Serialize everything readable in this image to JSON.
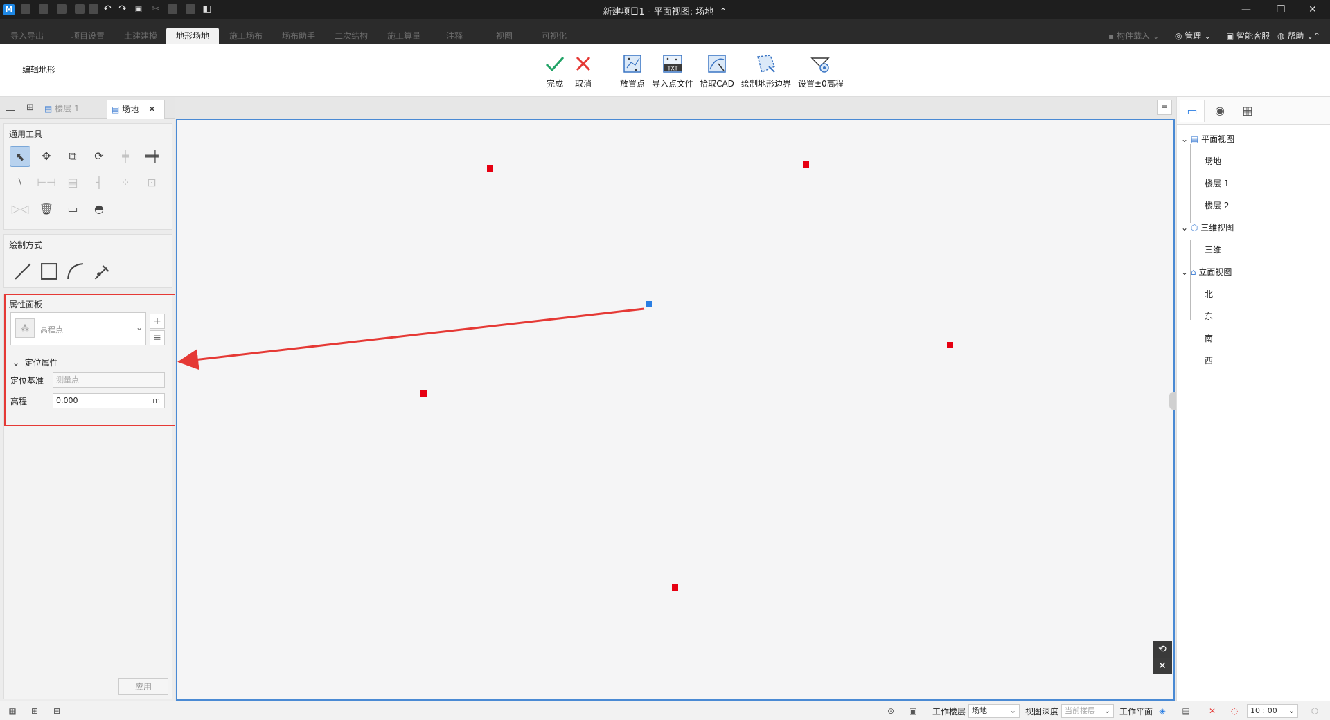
{
  "app": {
    "logo_letter": "M",
    "window_title": "新建项目1 - 平面视图: 场地",
    "title_chevron": "⌃"
  },
  "window_controls": {
    "minimize": "—",
    "restore": "❐",
    "close": "✕"
  },
  "ribbon_tabs": [
    {
      "label": "导入导出",
      "active": false
    },
    {
      "label": "项目设置",
      "active": false
    },
    {
      "label": "土建建模",
      "active": false
    },
    {
      "label": "地形场地",
      "active": true
    },
    {
      "label": "施工场布",
      "active": false
    },
    {
      "label": "场布助手",
      "active": false
    },
    {
      "label": "二次结构",
      "active": false
    },
    {
      "label": "施工算量",
      "active": false
    },
    {
      "label": "注释",
      "active": false
    },
    {
      "label": "视图",
      "active": false
    },
    {
      "label": "可视化",
      "active": false
    }
  ],
  "top_right": {
    "component_load": "构件载入",
    "manage": "管理",
    "service": "智能客服",
    "help": "帮助"
  },
  "ribbon": {
    "mode_label": "编辑地形",
    "finish": "完成",
    "cancel": "取消",
    "place_point": "放置点",
    "import_points": "导入点文件",
    "pick_cad": "拾取CAD",
    "draw_boundary": "绘制地形边界",
    "set_zero_elev": "设置±0高程",
    "txt_badge": "TXT",
    "accent_color": "#21a366",
    "cancel_color": "#e53935"
  },
  "view_tabs": {
    "floor1": "楼层 1",
    "site": "场地",
    "close": "✕"
  },
  "general_tools": {
    "title": "通用工具"
  },
  "draw_mode": {
    "title": "绘制方式"
  },
  "properties": {
    "title": "属性面板",
    "type_name": "高程点",
    "add": "+",
    "list": "≡",
    "section": "定位属性",
    "base_label": "定位基准",
    "base_placeholder": "测量点",
    "elev_label": "高程",
    "elev_value": "0.000",
    "elev_unit": "m",
    "apply": "应用"
  },
  "canvas": {
    "menu": "≡",
    "points_red": [
      {
        "id": "p1"
      },
      {
        "id": "p2"
      },
      {
        "id": "p3"
      },
      {
        "id": "p4"
      },
      {
        "id": "p5"
      }
    ],
    "point_color": "#e60012",
    "selected_color": "#2a7ee3"
  },
  "project_tree": {
    "plan_view": "平面视图",
    "site": "场地",
    "floor1": "楼层 1",
    "floor2": "楼层 2",
    "view3d": "三维视图",
    "d3": "三维",
    "elevation": "立面视图",
    "north": "北",
    "east": "东",
    "south": "南",
    "west": "西"
  },
  "status_bar": {
    "work_floor_label": "工作楼层",
    "work_floor_value": "场地",
    "view_depth_label": "视图深度",
    "view_depth_value": "当前楼层",
    "work_plane_label": "工作平面",
    "scale_value": "10 : 00"
  }
}
